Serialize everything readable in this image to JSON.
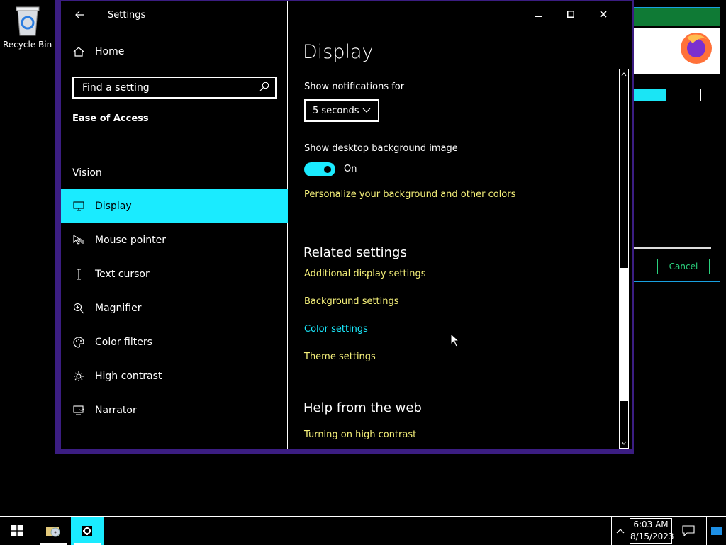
{
  "desktop": {
    "recycle_bin_label": "Recycle Bin"
  },
  "background_dialog": {
    "cancel_label": "Cancel",
    "progress": 0.45
  },
  "window": {
    "title": "Settings",
    "icons": {
      "back": "back-arrow-icon",
      "minimize": "minimize-icon",
      "maximize": "maximize-icon",
      "close": "close-icon"
    }
  },
  "sidebar": {
    "home_label": "Home",
    "search_placeholder": "Find a setting",
    "section_title": "Ease of Access",
    "group_title": "Vision",
    "items": [
      {
        "label": "Display",
        "icon": "monitor-icon",
        "active": true
      },
      {
        "label": "Mouse pointer",
        "icon": "mouse-pointer-icon",
        "active": false
      },
      {
        "label": "Text cursor",
        "icon": "text-cursor-icon",
        "active": false
      },
      {
        "label": "Magnifier",
        "icon": "magnifier-icon",
        "active": false
      },
      {
        "label": "Color filters",
        "icon": "palette-icon",
        "active": false
      },
      {
        "label": "High contrast",
        "icon": "sun-icon",
        "active": false
      },
      {
        "label": "Narrator",
        "icon": "narrator-icon",
        "active": false
      }
    ]
  },
  "main": {
    "page_title": "Display",
    "notifications_label": "Show notifications for",
    "notifications_value": "5 seconds",
    "bg_image_label": "Show desktop background image",
    "bg_image_toggle": "On",
    "personalize_link": "Personalize your background and other colors",
    "related_heading": "Related settings",
    "related_links": [
      "Additional display settings",
      "Background settings",
      "Color settings",
      "Theme settings"
    ],
    "help_heading": "Help from the web",
    "help_links": [
      "Turning on high contrast"
    ]
  },
  "taskbar": {
    "time": "6:03 AM",
    "date": "8/15/2023"
  },
  "colors": {
    "accent": "#1aebff",
    "link": "#f5f07a",
    "window_border": "#3b1d82"
  }
}
